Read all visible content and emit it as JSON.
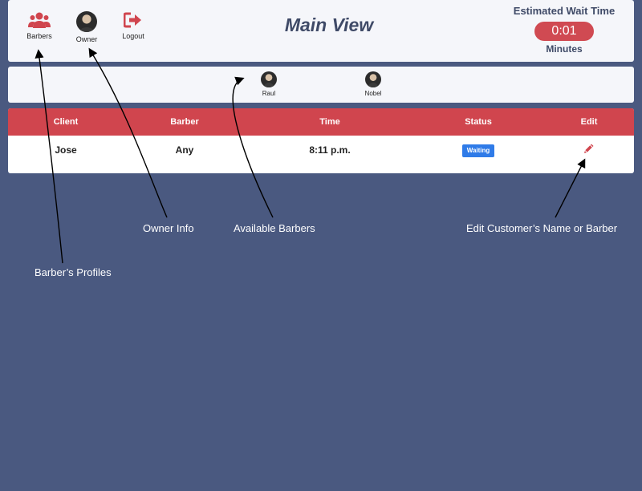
{
  "header": {
    "nav": [
      {
        "label": "Barbers",
        "icon": "users-icon"
      },
      {
        "label": "Owner",
        "icon": "avatar"
      },
      {
        "label": "Logout",
        "icon": "sign-out-icon"
      }
    ],
    "title": "Main View",
    "wait": {
      "label": "Estimated Wait Time",
      "value": "0:01",
      "unit": "Minutes"
    }
  },
  "barbers": [
    {
      "name": "Raul"
    },
    {
      "name": "Nobel"
    }
  ],
  "queue": {
    "columns": [
      "Client",
      "Barber",
      "Time",
      "Status",
      "Edit"
    ],
    "rows": [
      {
        "client": "Jose",
        "barber": "Any",
        "time": "8:11 p.m.",
        "status": "Waiting",
        "edit_icon": "pencil-icon"
      }
    ]
  },
  "annotations": {
    "owner": "Owner Info",
    "barbers_available": "Available Barbers",
    "edit": "Edit Customer’s Name or Barber",
    "profiles": "Barber’s Profiles"
  },
  "colors": {
    "background": "#4a5980",
    "accent_red": "#d0454e",
    "badge_blue": "#2f7be8",
    "title_text": "#3f4a67"
  }
}
